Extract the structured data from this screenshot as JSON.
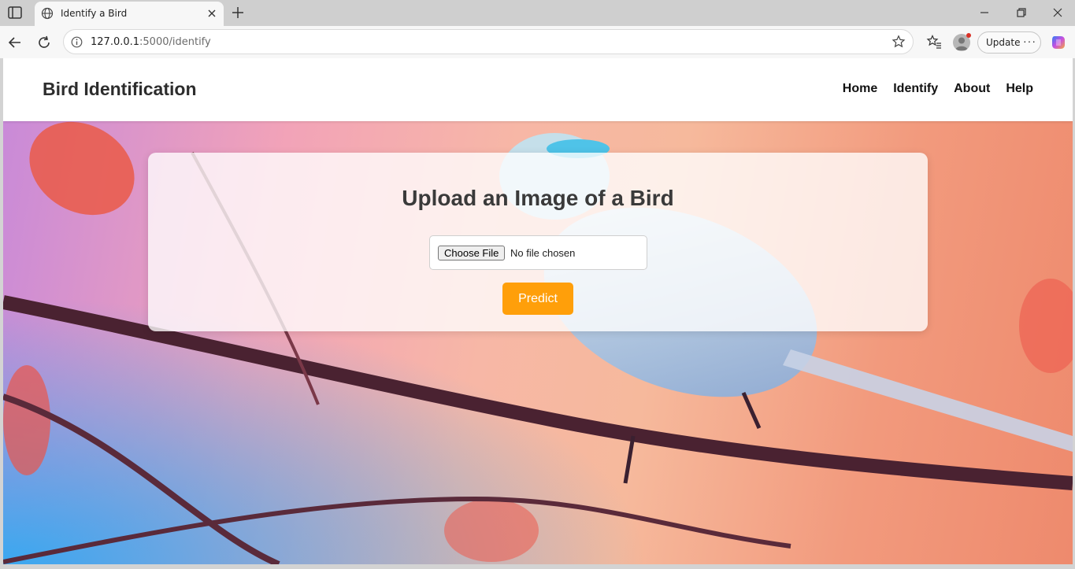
{
  "browser": {
    "tab_title": "Identify a Bird",
    "url_host": "127.0.0.1",
    "url_path": ":5000/identify",
    "update_label": "Update",
    "more_label": "···"
  },
  "site": {
    "brand": "Bird Identification",
    "nav": [
      "Home",
      "Identify",
      "About",
      "Help"
    ]
  },
  "upload": {
    "title": "Upload an Image of a Bird",
    "choose_file_label": "Choose File",
    "file_status": "No file chosen",
    "predict_label": "Predict"
  },
  "colors": {
    "predict_button": "#ff9f0a",
    "brand_text": "#2d2d2d"
  }
}
